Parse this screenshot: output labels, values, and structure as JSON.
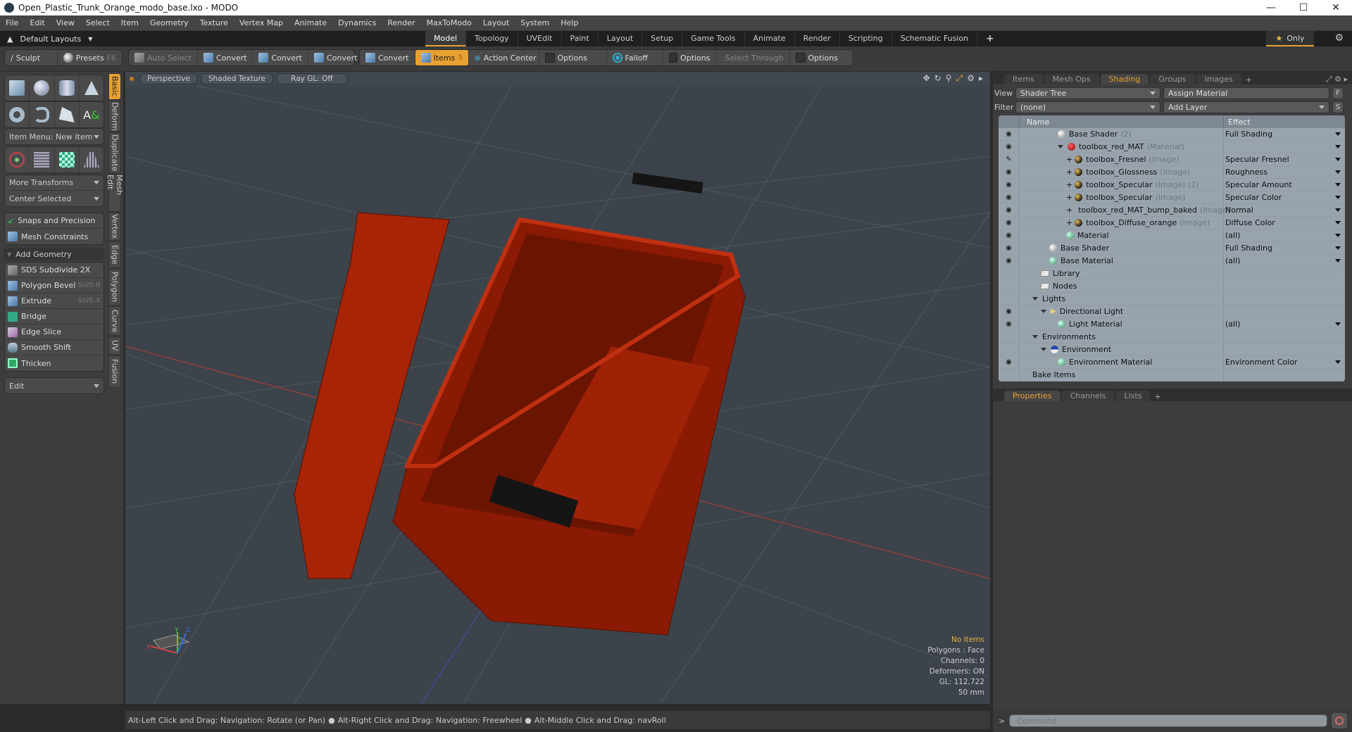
{
  "window": {
    "title": "Open_Plastic_Trunk_Orange_modo_base.lxo - MODO",
    "controls": [
      "minimize",
      "maximize",
      "close"
    ]
  },
  "menu": [
    "File",
    "Edit",
    "View",
    "Select",
    "Item",
    "Geometry",
    "Texture",
    "Vertex Map",
    "Animate",
    "Dynamics",
    "Render",
    "MaxToModo",
    "Layout",
    "System",
    "Help"
  ],
  "layoutbar": {
    "layouts_label": "Default Layouts",
    "tabs": [
      "Model",
      "Topology",
      "UVEdit",
      "Paint",
      "Layout",
      "Setup",
      "Game Tools",
      "Animate",
      "Render",
      "Scripting",
      "Schematic Fusion"
    ],
    "active_tab": "Model",
    "add_tab": "+",
    "only_label": "Only"
  },
  "toolbar": {
    "sculpt": "Sculpt",
    "presets": "Presets",
    "presets_key": "F6",
    "auto_select": "Auto Select",
    "convert": [
      "Convert",
      "Convert",
      "Convert",
      "Convert"
    ],
    "items": "Items",
    "items_count": "5",
    "action_center": "Action Center",
    "options1": "Options",
    "falloff": "Falloff",
    "options2": "Options",
    "select_through": "Select Through",
    "options3": "Options"
  },
  "left_panel": {
    "item_menu": "Item Menu: New Item",
    "more_transforms": "More Transforms",
    "center_selected": "Center Selected",
    "snaps": "Snaps and Precision",
    "mesh_constraints": "Mesh Constraints",
    "add_geometry": "Add Geometry",
    "tools": [
      {
        "label": "SDS Subdivide 2X",
        "shortcut": ""
      },
      {
        "label": "Polygon Bevel",
        "shortcut": "Shift-B"
      },
      {
        "label": "Extrude",
        "shortcut": "Shift-X"
      },
      {
        "label": "Bridge",
        "shortcut": ""
      },
      {
        "label": "Edge Slice",
        "shortcut": ""
      },
      {
        "label": "Smooth Shift",
        "shortcut": ""
      },
      {
        "label": "Thicken",
        "shortcut": ""
      }
    ],
    "edit": "Edit",
    "side_tabs": [
      "Basic",
      "Deform",
      "Duplicate",
      "Mesh Edit",
      "Vertex",
      "Edge",
      "Polygon",
      "Curve",
      "UV",
      "Fusion"
    ],
    "active_side_tab": "Basic"
  },
  "viewport": {
    "view": "Perspective",
    "shading": "Shaded Texture",
    "raygl": "Ray GL: Off",
    "hud": {
      "items": "No Items",
      "polygons": "Polygons : Face",
      "channels": "Channels: 0",
      "deformers": "Deformers: ON",
      "gl": "GL: 112,722",
      "scale": "50 mm"
    },
    "axis_labels": {
      "x": "X",
      "y": "Y",
      "z": "Z"
    },
    "model_color": "#b82a08"
  },
  "status": {
    "hint1": "Alt-Left Click and Drag: Navigation: Rotate (or Pan)",
    "hint2": "Alt-Right Click and Drag: Navigation: Freewheel",
    "hint3": "Alt-Middle Click and Drag: navRoll"
  },
  "right_panel": {
    "tabs": [
      "Items",
      "Mesh Ops",
      "Shading",
      "Groups",
      "Images"
    ],
    "active_tab": "Shading",
    "view_label": "View",
    "view_value": "Shader Tree",
    "assign_material": "Assign Material",
    "f_btn": "F",
    "filter_label": "Filter",
    "filter_value": "(none)",
    "add_layer": "Add Layer",
    "s_btn": "S",
    "col_name": "Name",
    "col_effect": "Effect",
    "rows": [
      {
        "eye": "eye",
        "indent": 3,
        "icon": "white",
        "name": "Base Shader",
        "suffix": "(2)",
        "effect": "Full Shading",
        "dd": true
      },
      {
        "eye": "eye",
        "indent": 3,
        "icon": "red",
        "name": "toolbox_red_MAT",
        "suffix": "(Material)",
        "effect": "",
        "dd": true,
        "expand": true
      },
      {
        "eye": "brush",
        "indent": 4,
        "icon": "img",
        "name": "toolbox_Fresnel",
        "suffix": "(Image)",
        "effect": "Specular Fresnel",
        "dd": true,
        "plus": true
      },
      {
        "eye": "eye",
        "indent": 4,
        "icon": "img",
        "name": "toolbox_Glossness",
        "suffix": "(Image)",
        "effect": "Roughness",
        "dd": true,
        "plus": true
      },
      {
        "eye": "eye",
        "indent": 4,
        "icon": "img",
        "name": "toolbox_Specular",
        "suffix": "(Image) (2)",
        "effect": "Specular Amount",
        "dd": true,
        "plus": true
      },
      {
        "eye": "eye",
        "indent": 4,
        "icon": "img",
        "name": "toolbox_Specular",
        "suffix": "(Image)",
        "effect": "Specular Color",
        "dd": true,
        "plus": true
      },
      {
        "eye": "eye",
        "indent": 4,
        "icon": "img",
        "name": "toolbox_red_MAT_bump_baked",
        "suffix": "(Image)",
        "effect": "Normal",
        "dd": true,
        "plus": true
      },
      {
        "eye": "eye",
        "indent": 4,
        "icon": "img",
        "name": "toolbox_Diffuse_orange",
        "suffix": "(Image)",
        "effect": "Diffuse Color",
        "dd": true,
        "plus": true
      },
      {
        "eye": "eye",
        "indent": 4,
        "icon": "green",
        "name": "Material",
        "suffix": "",
        "effect": "(all)",
        "dd": true
      },
      {
        "eye": "eye",
        "indent": 2,
        "icon": "white",
        "name": "Base Shader",
        "suffix": "",
        "effect": "Full Shading",
        "dd": true
      },
      {
        "eye": "eye",
        "indent": 2,
        "icon": "green",
        "name": "Base Material",
        "suffix": "",
        "effect": "(all)",
        "dd": true
      },
      {
        "eye": "",
        "indent": 1,
        "icon": "folder",
        "name": "Library",
        "suffix": "",
        "effect": "",
        "dd": false
      },
      {
        "eye": "",
        "indent": 1,
        "icon": "folder",
        "name": "Nodes",
        "suffix": "",
        "effect": "",
        "dd": false
      },
      {
        "eye": "",
        "indent": 0,
        "icon": "",
        "name": "Lights",
        "suffix": "",
        "effect": "",
        "dd": false,
        "expand": true
      },
      {
        "eye": "eye",
        "indent": 1,
        "icon": "light",
        "name": "Directional Light",
        "suffix": "",
        "effect": "",
        "dd": false,
        "expand": true
      },
      {
        "eye": "eye",
        "indent": 3,
        "icon": "green",
        "name": "Light Material",
        "suffix": "",
        "effect": "(all)",
        "dd": true
      },
      {
        "eye": "",
        "indent": 0,
        "icon": "",
        "name": "Environments",
        "suffix": "",
        "effect": "",
        "dd": false,
        "expand": true
      },
      {
        "eye": "",
        "indent": 1,
        "icon": "env",
        "name": "Environment",
        "suffix": "",
        "effect": "",
        "dd": false,
        "expand": true
      },
      {
        "eye": "eye",
        "indent": 3,
        "icon": "green",
        "name": "Environment Material",
        "suffix": "",
        "effect": "Environment Color",
        "dd": true
      },
      {
        "eye": "",
        "indent": 0,
        "icon": "",
        "name": "Bake Items",
        "suffix": "",
        "effect": "",
        "dd": false
      }
    ],
    "bottom_tabs": [
      "Properties",
      "Channels",
      "Lists"
    ],
    "bottom_active": "Properties",
    "command_placeholder": "Command",
    "command_prompt": ">"
  }
}
